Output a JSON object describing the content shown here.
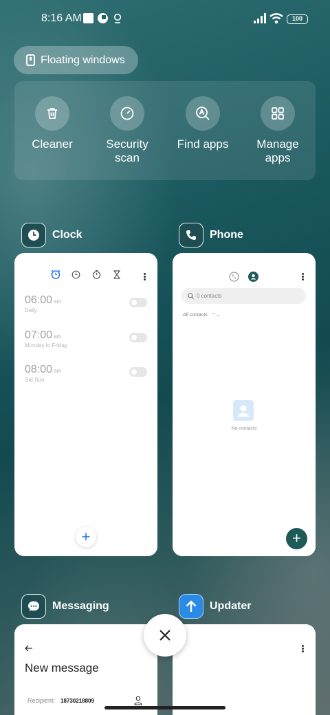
{
  "status_bar": {
    "time": "8:16 AM",
    "battery": "100"
  },
  "floating_windows": {
    "label": "Floating windows"
  },
  "quick_actions": [
    {
      "label": "Cleaner",
      "icon": "trash-icon"
    },
    {
      "label": "Security scan",
      "icon": "security-scan-icon"
    },
    {
      "label": "Find apps",
      "icon": "find-apps-icon"
    },
    {
      "label": "Manage apps",
      "icon": "manage-apps-icon"
    }
  ],
  "apps": {
    "clock": {
      "name": "Clock",
      "alarms": [
        {
          "time": "06:00",
          "ampm": "am",
          "repeat": "Daily"
        },
        {
          "time": "07:00",
          "ampm": "am",
          "repeat": "Monday to Friday"
        },
        {
          "time": "08:00",
          "ampm": "am",
          "repeat": "Sat Sun"
        }
      ],
      "add_label": "+"
    },
    "phone": {
      "name": "Phone",
      "search_placeholder": "0 contacts",
      "filter": "All contacts",
      "empty_text": "No contacts",
      "fab_label": "+"
    },
    "messaging": {
      "name": "Messaging",
      "title": "New message",
      "recipient_label": "Recipient:",
      "recipient_value": "18730218809"
    },
    "updater": {
      "name": "Updater"
    }
  },
  "colors": {
    "accent_blue": "#2a7de1",
    "phone_green": "#1e5a58"
  }
}
